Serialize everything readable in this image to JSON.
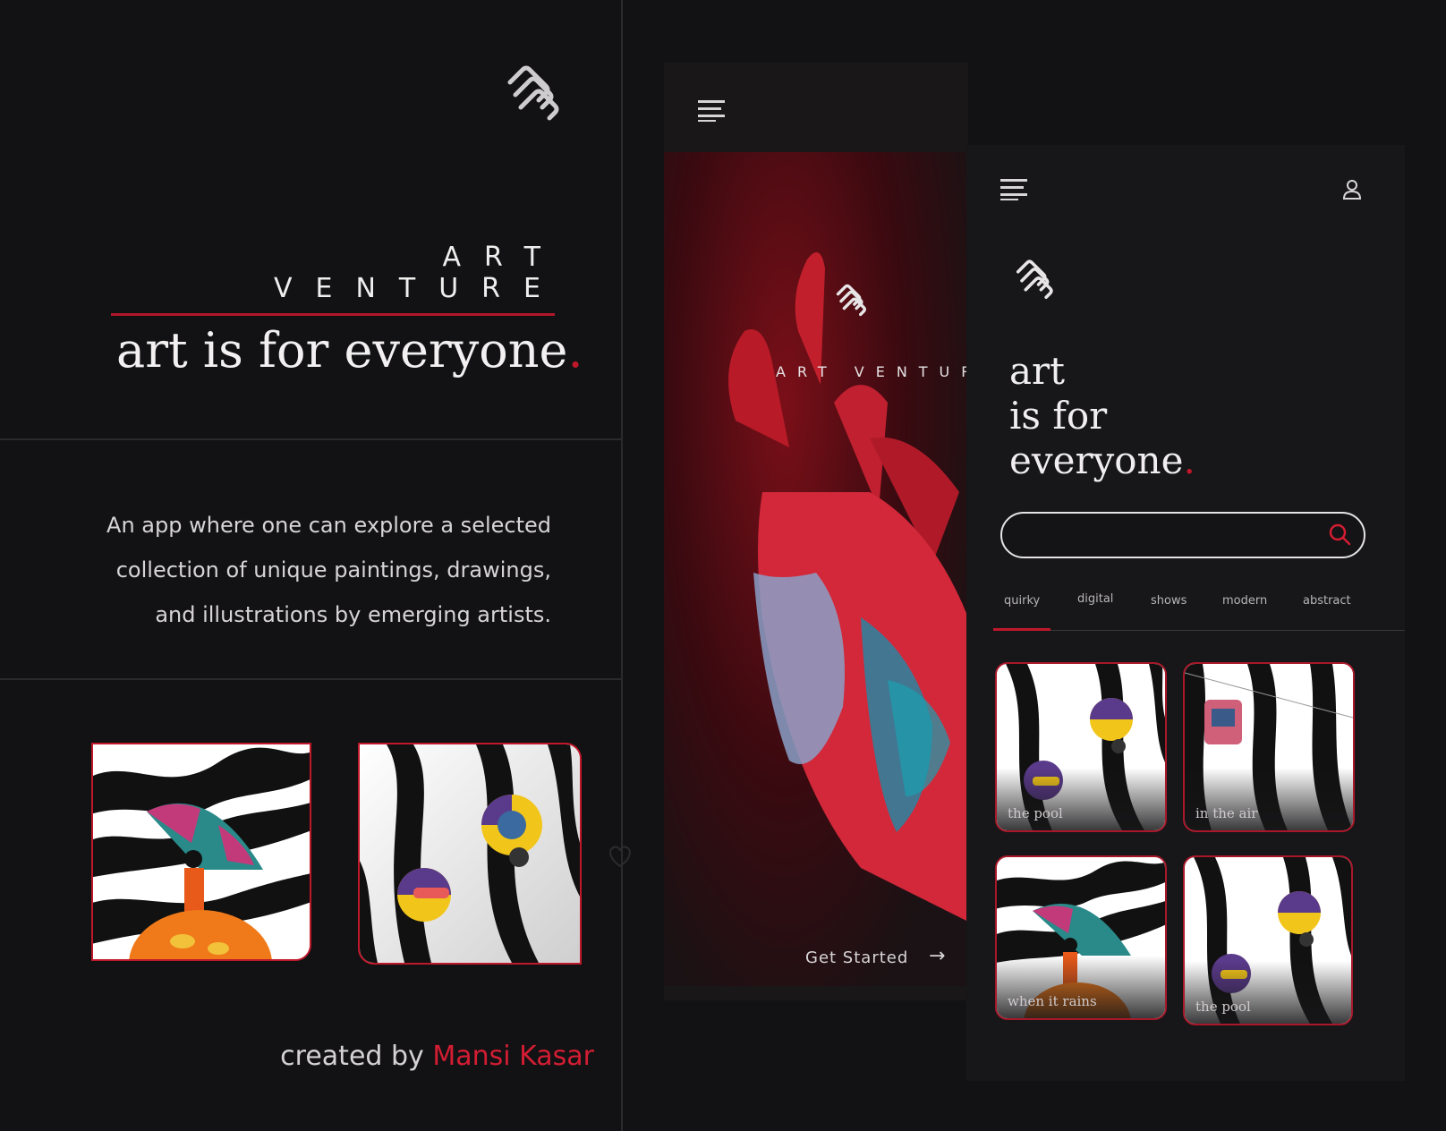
{
  "left": {
    "brand": "ART VENTURE",
    "tagline": "art is for everyone",
    "tagline_dot": ".",
    "description": [
      "An app where one can explore a selected",
      "collection of unique paintings, drawings,",
      "and illustrations by emerging artists."
    ],
    "credit_prefix": "created by",
    "credit_name": "Mansi Kasar"
  },
  "phone1": {
    "brand": "ART VENTUR",
    "cta": "Get Started",
    "cta_icon": "arrow-right-icon"
  },
  "phone2": {
    "title_lines": [
      "art",
      "is for",
      "everyone"
    ],
    "title_dot": ".",
    "search_placeholder": "",
    "tabs": [
      "quirky",
      "digital",
      "shows",
      "modern",
      "abstract"
    ],
    "active_tab": "quirky",
    "gallery": [
      {
        "caption": "the pool"
      },
      {
        "caption": "in the air"
      },
      {
        "caption": "when it rains"
      },
      {
        "caption": "the pool"
      }
    ]
  },
  "colors": {
    "background": "#121113",
    "accent": "#c0182b",
    "text": "#e6e3e5"
  }
}
